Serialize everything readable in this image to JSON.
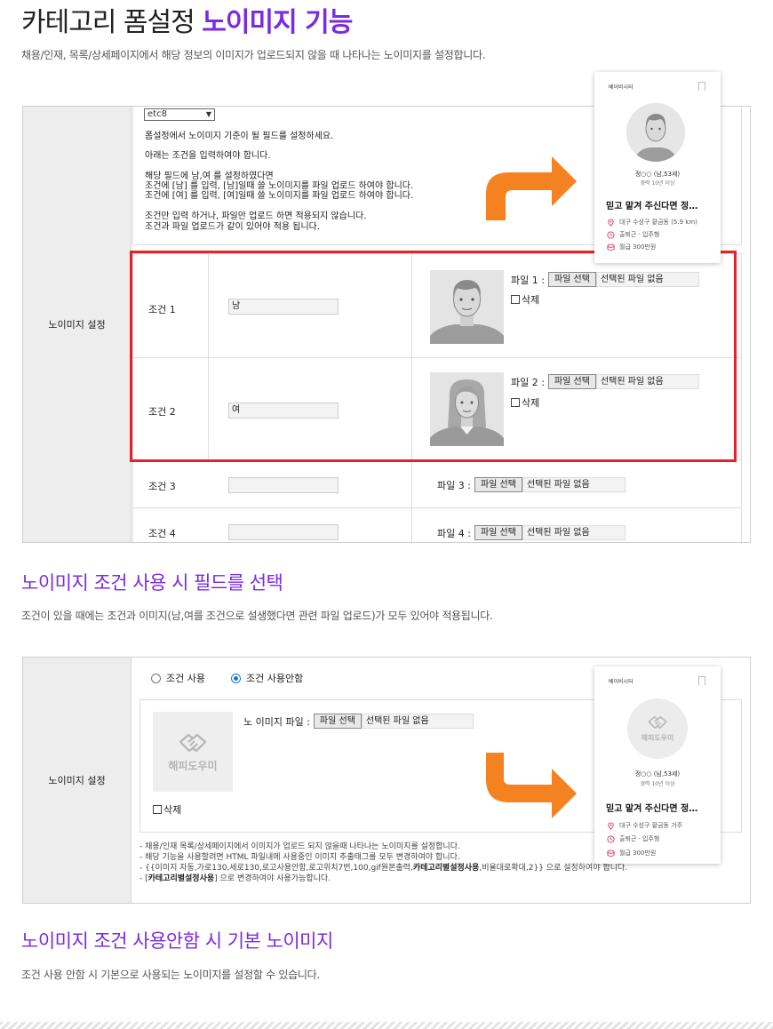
{
  "header": {
    "title_main": "카테고리 폼설정 ",
    "title_accent": "노이미지 기능",
    "description": "채용/인재, 목록/상세페이지에서 해당 정보의 이미지가 업로드되지 않을 때 나타나는 노이미지를 설정합니다."
  },
  "panel1": {
    "label": "노이미지 설정",
    "select_value": "etc8",
    "info_lines": [
      "폼설정에서 노이미지 기준이 될 필드를 설정하세요.",
      "아래는 조건을 입력하여야 합니다.",
      "해당 필드에 남,여 를 설정하였다면",
      "조건에 [남] 를 입력, [남]일때 쓸 노이미지를 파일 업로드 하여야 합니다.",
      "조건에 [여] 를 입력, [여]일때 쓸 노이미지를 파일 업로드 하여야 합니다.",
      "조건만 입력 하거나, 파일만 업로드 하면 적용되지 않습니다.",
      "조건과 파일 업로드가 같이 있어야 적용 됩니다."
    ],
    "rows": [
      {
        "cond_label": "조건 1",
        "value": "남",
        "file_label": "파일 1 :",
        "btn": "파일 선택",
        "file_status": "선택된 파일 없음",
        "delete_label": "삭제"
      },
      {
        "cond_label": "조건 2",
        "value": "여",
        "file_label": "파일 2 :",
        "btn": "파일 선택",
        "file_status": "선택된 파일 없음",
        "delete_label": "삭제"
      },
      {
        "cond_label": "조건 3",
        "value": "",
        "file_label": "파일 3 :",
        "btn": "파일 선택",
        "file_status": "선택된 파일 없음"
      },
      {
        "cond_label": "조건 4",
        "value": "",
        "file_label": "파일 4 :",
        "btn": "파일 선택",
        "file_status": "선택된 파일 없음"
      }
    ]
  },
  "card1": {
    "brand": "베이비시터",
    "name": "정○○ (남,53세)",
    "exp": "경력 10년 이상",
    "headline": "믿고 맡겨 주신다면 정…",
    "meta": [
      "대구 수성구 황금동 (5.9 km)",
      "출퇴근 · 입주형",
      "월급 300만원"
    ]
  },
  "section2": {
    "title": "노이미지 조건 사용 시 필드를 선택",
    "description": "조건이 있을 때에는 조건과 이미지(남,여를 조건으로 설생했다면 관련 파일 업로드)가 모두 있어야 적용됩니다."
  },
  "panel2": {
    "label": "노이미지 설정",
    "radio_use": "조건 사용",
    "radio_nouse": "조건 사용안함",
    "logo_text": "해피도우미",
    "file_label": "노 이미지 파일 :",
    "btn": "파일 선택",
    "file_status": "선택된 파일 없음",
    "delete_label": "삭제",
    "notes": [
      "- 채용/인재 목록/상세페이지에서 이미지가 업로드 되지 않을때 나타나는 노이미지를 설정합니다.",
      "- 해당 기능을 사용할려면 HTML 파일내에 사용중인 이미지 추출태그를 모두 변경하여야 합니다."
    ],
    "note3_a": "- {{이미지 자동,가로130,세로130,로고사용안함,로고위치7번,100,gif원본출력,",
    "note3_b": "카테고리별설정사용",
    "note3_c": ",비율대로확대,2}} 으로 설정하여야 합니다.",
    "note4_a": "- [",
    "note4_b": "카테고리별설정사용",
    "note4_c": "] 으로 변경하여야 사용가능합니다."
  },
  "card2": {
    "brand": "베이비시터",
    "logo_text": "해피도우미",
    "name": "정○○ (남,53세)",
    "exp": "경력 10년 이상",
    "headline": "믿고 맡겨 주신다면 정…",
    "meta": [
      "대구 수성구 황금동 거주",
      "출퇴근 · 입주형",
      "월급 300만원"
    ]
  },
  "section3": {
    "title": "노이미지 조건 사용안함 시 기본 노이미지",
    "description": "조건 사용 안함 시 기본으로 사용되는 노이미지를 설정할 수 있습니다."
  },
  "colors": {
    "accent": "#7b2be2",
    "arrow": "#f58220",
    "highlight": "#e8202a"
  }
}
